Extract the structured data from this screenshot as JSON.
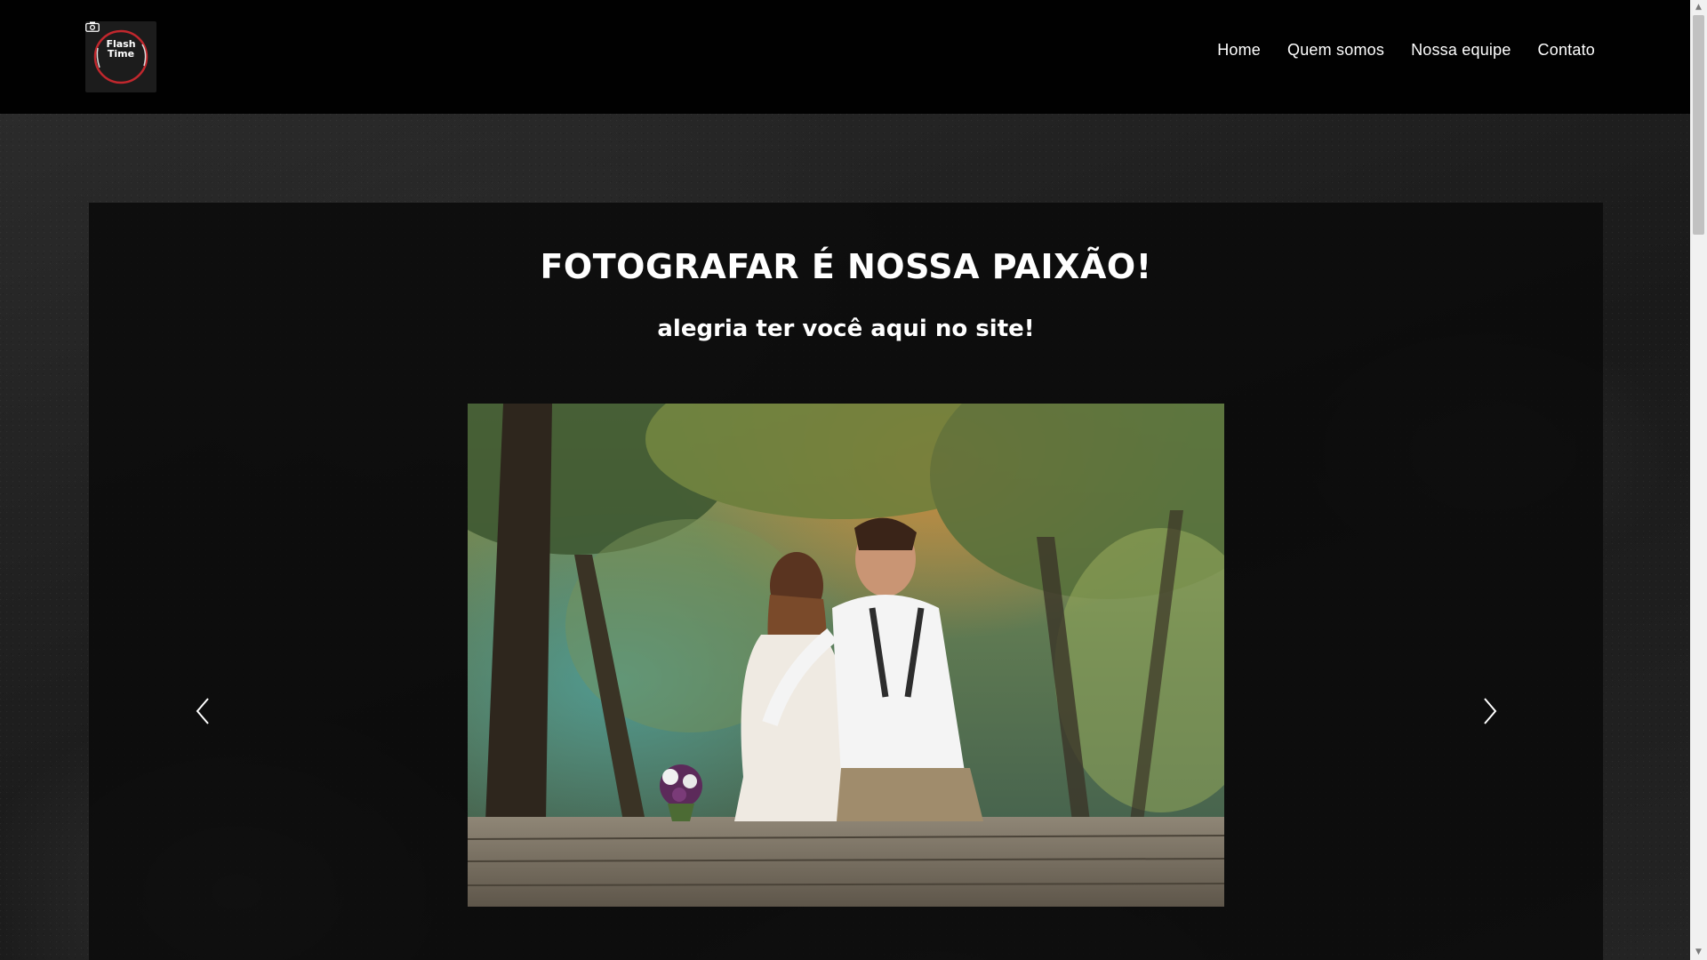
{
  "header": {
    "logo": {
      "line1": "Flash",
      "line2": "Time",
      "icon": "camera-icon"
    },
    "nav": [
      {
        "label": "Home"
      },
      {
        "label": "Quem somos"
      },
      {
        "label": "Nossa equipe"
      },
      {
        "label": "Contato"
      }
    ]
  },
  "hero": {
    "title": "FOTOGRAFAR É NOSSA PAIXÃO!",
    "subtitle": "alegria ter você aqui no site!",
    "slideshow": {
      "prev_icon": "chevron-left-icon",
      "next_icon": "chevron-right-icon"
    }
  },
  "colors": {
    "header_bg": "#010101",
    "panel_bg": "#0a0a0a",
    "text": "#ffffff",
    "logo_ring": "#c1272d"
  }
}
